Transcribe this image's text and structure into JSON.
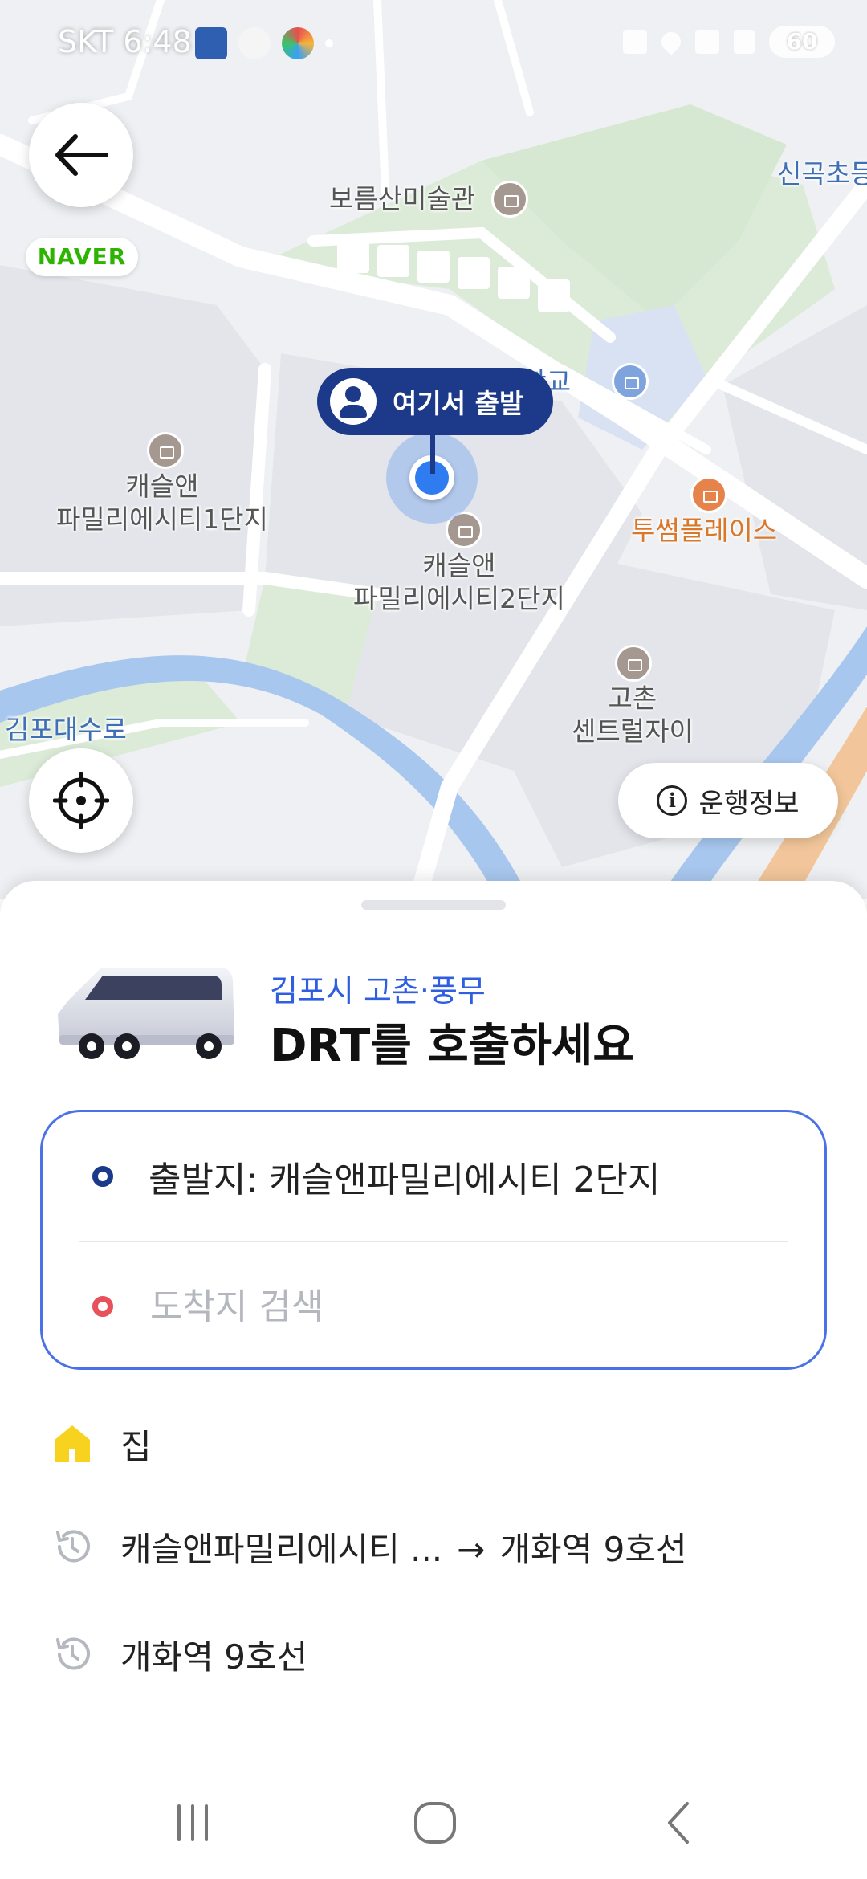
{
  "status_bar": {
    "carrier": "SKT",
    "time": "6:48",
    "battery": "60"
  },
  "map": {
    "provider": "NAVER",
    "pois": [
      {
        "id": "gallery",
        "label": "보름산미술관"
      },
      {
        "id": "school",
        "label": "중학교"
      },
      {
        "id": "apt1",
        "label": "캐슬앤\n파밀리에시티1단지"
      },
      {
        "id": "apt2",
        "label": "캐슬앤\n파밀리에시티2단지"
      },
      {
        "id": "cafe",
        "label": "투썸플레이스"
      },
      {
        "id": "central",
        "label": "고촌\n센트럴자이"
      },
      {
        "id": "elementary",
        "label": "신곡초등"
      },
      {
        "id": "road",
        "label": "김포대수로"
      }
    ],
    "pin_label": "여기서 출발",
    "info_button": "운행정보"
  },
  "sheet": {
    "region": "김포시 고촌·풍무",
    "title": "DRT를 호출하세요",
    "origin": "출발지: 캐슬앤파밀리에시티 2단지",
    "destination_placeholder": "도착지 검색",
    "home_label": "집",
    "recents": [
      {
        "from": "캐슬앤파밀리에시티 ...",
        "to": "개화역 9호선"
      },
      {
        "label": "개화역 9호선"
      }
    ]
  },
  "colors": {
    "accent_blue": "#2f5fe0",
    "pin_navy": "#1d3a8a",
    "dest_red": "#e8505b",
    "home_yellow": "#f7d21e"
  }
}
